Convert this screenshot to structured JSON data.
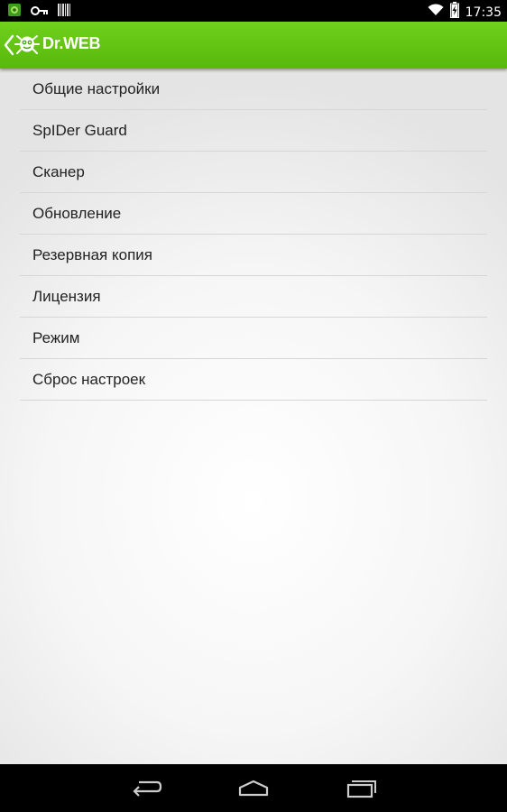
{
  "status_bar": {
    "time": "17:35",
    "left_icons": [
      "app-notification-icon",
      "key-icon",
      "barcode-icon"
    ],
    "right_icons": [
      "wifi-icon",
      "battery-charging-icon"
    ]
  },
  "action_bar": {
    "title": "Dr.WEB",
    "back_icon": "chevron-left-icon",
    "logo_icon": "drweb-spider-logo",
    "colors": {
      "top": "#6fd11b",
      "bottom": "#58b80c"
    }
  },
  "settings_menu": {
    "items": [
      {
        "label": "Общие настройки"
      },
      {
        "label": "SpIDer Guard"
      },
      {
        "label": "Сканер"
      },
      {
        "label": "Обновление"
      },
      {
        "label": "Резервная копия"
      },
      {
        "label": "Лицензия"
      },
      {
        "label": "Режим"
      },
      {
        "label": "Сброс настроек"
      }
    ]
  },
  "navigation_bar": {
    "buttons": [
      "back-icon",
      "home-icon",
      "recent-apps-icon"
    ]
  }
}
